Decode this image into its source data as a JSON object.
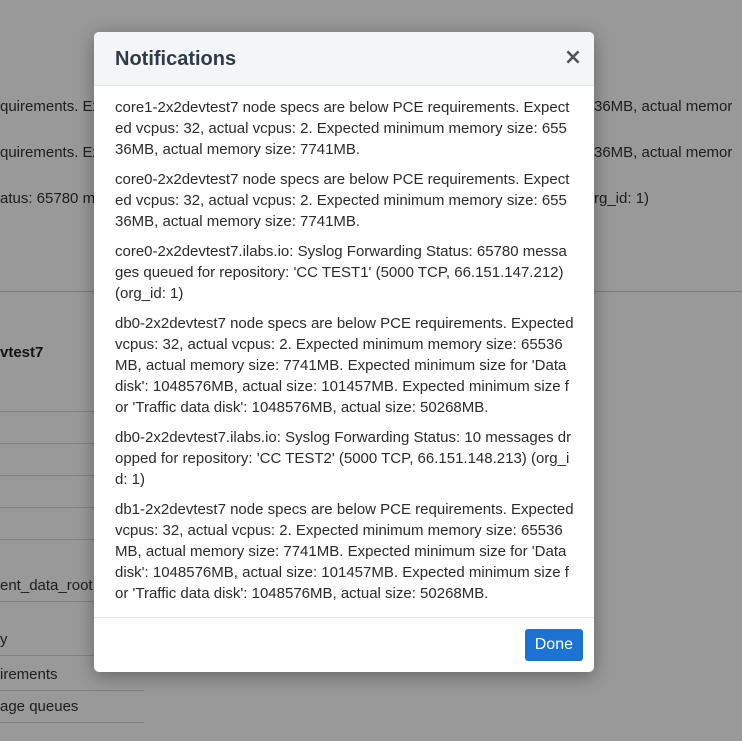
{
  "background": {
    "lines": [
      {
        "left_text": "quirements. Ex",
        "right_text": "36MB, actual memor"
      },
      {
        "left_text": "quirements. Ex",
        "right_text": "36MB, actual memor"
      },
      {
        "left_text": "atus: 65780 m",
        "right_text": "rg_id: 1)"
      }
    ],
    "node_heading": "vtest7",
    "rows": [
      "",
      "",
      "",
      "",
      "",
      "ent_data_root",
      "y",
      "irements",
      "age queues"
    ]
  },
  "modal": {
    "title": "Notifications",
    "close_label": "×",
    "done_label": "Done",
    "notifications": [
      "core1-2x2devtest7 node specs are below PCE requirements. Expected vcpus: 32, actual vcpus: 2. Expected minimum memory size: 65536MB, actual memory size: 7741MB.",
      "core0-2x2devtest7 node specs are below PCE requirements. Expected vcpus: 32, actual vcpus: 2. Expected minimum memory size: 65536MB, actual memory size: 7741MB.",
      "core0-2x2devtest7.ilabs.io: Syslog Forwarding Status: 65780 messages queued for repository: 'CC TEST1' (5000 TCP, 66.151.147.212) (org_id: 1)",
      "db0-2x2devtest7 node specs are below PCE requirements. Expected vcpus: 32, actual vcpus: 2. Expected minimum memory size: 65536MB, actual memory size: 7741MB. Expected minimum size for 'Data disk': 1048576MB, actual size: 101457MB. Expected minimum size for 'Traffic data disk': 1048576MB, actual size: 50268MB.",
      "db0-2x2devtest7.ilabs.io: Syslog Forwarding Status: 10 messages dropped for repository: 'CC TEST2' (5000 TCP, 66.151.148.213) (org_id: 1)",
      "db1-2x2devtest7 node specs are below PCE requirements. Expected vcpus: 32, actual vcpus: 2. Expected minimum memory size: 65536MB, actual memory size: 7741MB. Expected minimum size for 'Data disk': 1048576MB, actual size: 101457MB. Expected minimum size for 'Traffic data disk': 1048576MB, actual size: 50268MB."
    ]
  }
}
